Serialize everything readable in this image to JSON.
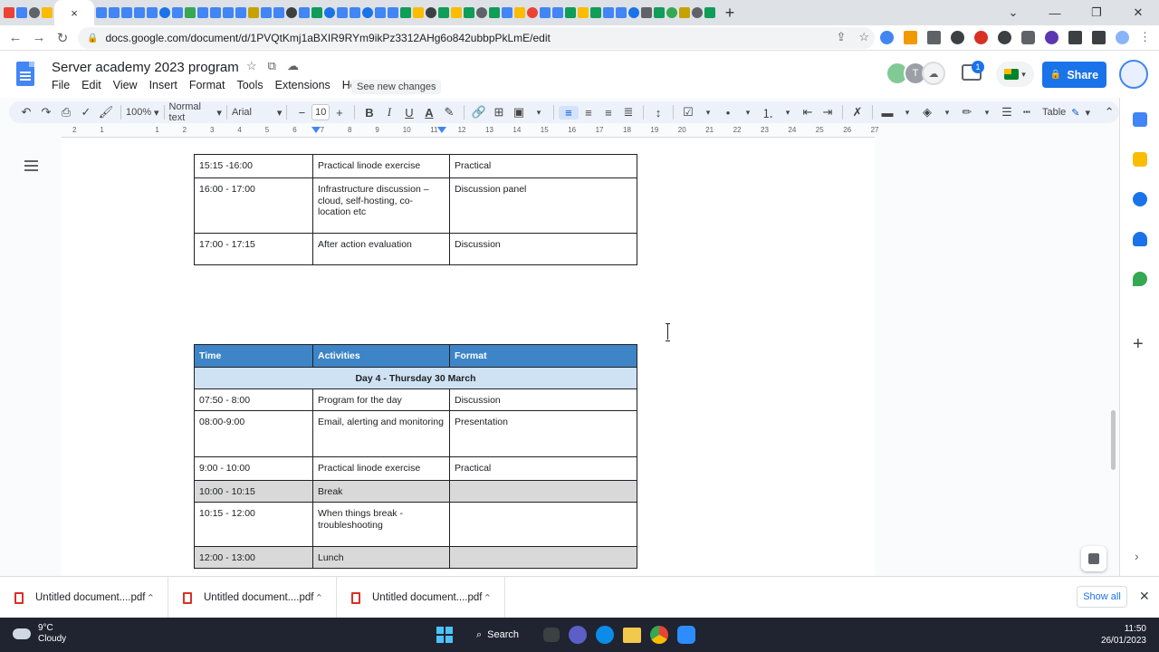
{
  "browser": {
    "url": "docs.google.com/document/d/1PVQtKmj1aBXIR9RYm9ikPz3312AHg6o842ubbpPkLmE/edit",
    "tab_close_glyph": "×",
    "new_tab_glyph": "+"
  },
  "docs": {
    "title": "Server academy 2023 program",
    "menu": [
      "File",
      "Edit",
      "View",
      "Insert",
      "Format",
      "Tools",
      "Extensions",
      "Help"
    ],
    "see_new_changes": "See new changes",
    "share_label": "Share",
    "collaborator_initial": "T",
    "comment_count": "1",
    "toolbar": {
      "zoom": "100%",
      "style": "Normal text",
      "font": "Arial",
      "font_size": "10",
      "mode_label": "Table"
    },
    "ruler_numbers": [
      "2",
      "1",
      "",
      "1",
      "2",
      "3",
      "4",
      "5",
      "6",
      "7",
      "8",
      "9",
      "10",
      "11",
      "12",
      "13",
      "14",
      "15",
      "16",
      "17",
      "18",
      "19",
      "20",
      "21",
      "22",
      "23",
      "24",
      "25",
      "26",
      "27"
    ]
  },
  "table1": {
    "rows": [
      {
        "time": "15:15 -16:00",
        "activity": "Practical linode exercise",
        "format": "Practical"
      },
      {
        "time": "16:00 - 17:00",
        "activity": "Infrastructure discussion – cloud, self-hosting, co-location etc",
        "format": "Discussion panel"
      },
      {
        "time": "17:00 - 17:15",
        "activity": "After action evaluation",
        "format": "Discussion"
      }
    ]
  },
  "table2": {
    "headers": {
      "time": "Time",
      "activities": "Activities",
      "format": "Format"
    },
    "day": "Day 4 - Thursday 30 March",
    "rows": [
      {
        "time": "07:50 - 8:00",
        "activity": "Program for the day",
        "format": "Discussion"
      },
      {
        "time": "08:00-9:00",
        "activity": "Email, alerting and monitoring",
        "format": "Presentation"
      },
      {
        "time": "9:00 - 10:00",
        "activity": "Practical linode exercise",
        "format": "Practical"
      },
      {
        "time": "10:00 - 10:15",
        "activity": "Break",
        "format": ""
      },
      {
        "time": "10:15 - 12:00",
        "activity": "When things break - troubleshooting",
        "format": ""
      },
      {
        "time": "12:00 - 13:00",
        "activity": "Lunch",
        "format": ""
      }
    ]
  },
  "downloads": {
    "items": [
      "Untitled document....pdf",
      "Untitled document....pdf",
      "Untitled document....pdf"
    ],
    "show_all": "Show all"
  },
  "taskbar": {
    "temperature": "9°C",
    "condition": "Cloudy",
    "search_label": "Search",
    "time": "11:50",
    "date": "26/01/2023"
  },
  "colors": {
    "header_blue": "#3d85c6",
    "day_row_blue": "#cfe2f3",
    "grey_row": "#d9d9d9",
    "share_blue": "#1a73e8"
  }
}
